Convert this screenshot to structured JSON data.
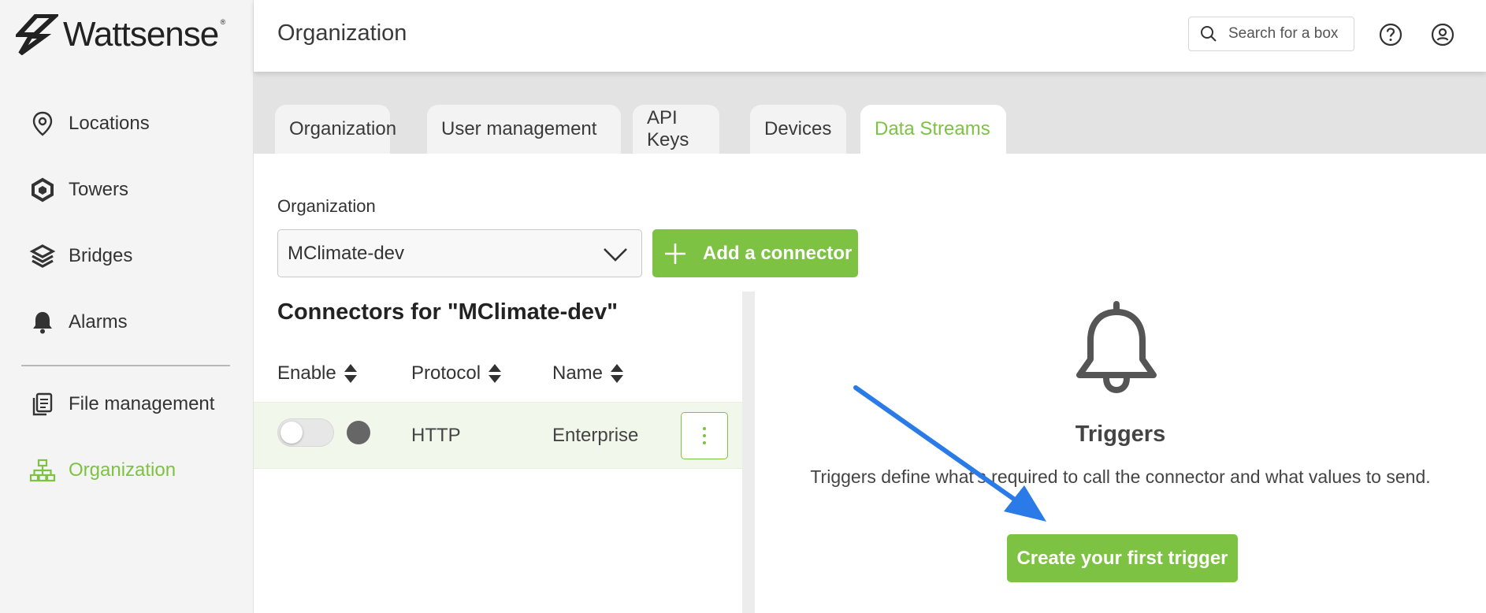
{
  "brand": {
    "name": "Wattsense",
    "reg": "®",
    "accent": "#7dc242",
    "arrow_color": "#2a7be8"
  },
  "sidebar": {
    "items": [
      {
        "label": "Locations",
        "icon": "location-pin-icon"
      },
      {
        "label": "Towers",
        "icon": "towers-icon"
      },
      {
        "label": "Bridges",
        "icon": "bridges-icon"
      },
      {
        "label": "Alarms",
        "icon": "bell-icon"
      },
      {
        "label": "File management",
        "icon": "file-management-icon"
      },
      {
        "label": "Organization",
        "icon": "organization-tree-icon",
        "active": true
      }
    ]
  },
  "header": {
    "title": "Organization",
    "search_placeholder": "Search for a box",
    "help_icon": "help-icon",
    "user_icon": "user-account-icon"
  },
  "tabs": [
    {
      "label": "Organization"
    },
    {
      "label": "User management"
    },
    {
      "label": "API Keys"
    },
    {
      "label": "Devices"
    },
    {
      "label": "Data Streams",
      "active": true
    }
  ],
  "main": {
    "org_label": "Organization",
    "org_selected": "MClimate-dev",
    "add_connector_label": "Add a connector",
    "connectors_title": "Connectors for \"MClimate-dev\"",
    "columns": {
      "enable": "Enable",
      "protocol": "Protocol",
      "name": "Name"
    },
    "rows": [
      {
        "enabled": false,
        "protocol": "HTTP",
        "name": "Enterprise"
      }
    ]
  },
  "triggers": {
    "title": "Triggers",
    "description": "Triggers define what's required to call the connector and what values to send.",
    "cta": "Create your first trigger"
  }
}
